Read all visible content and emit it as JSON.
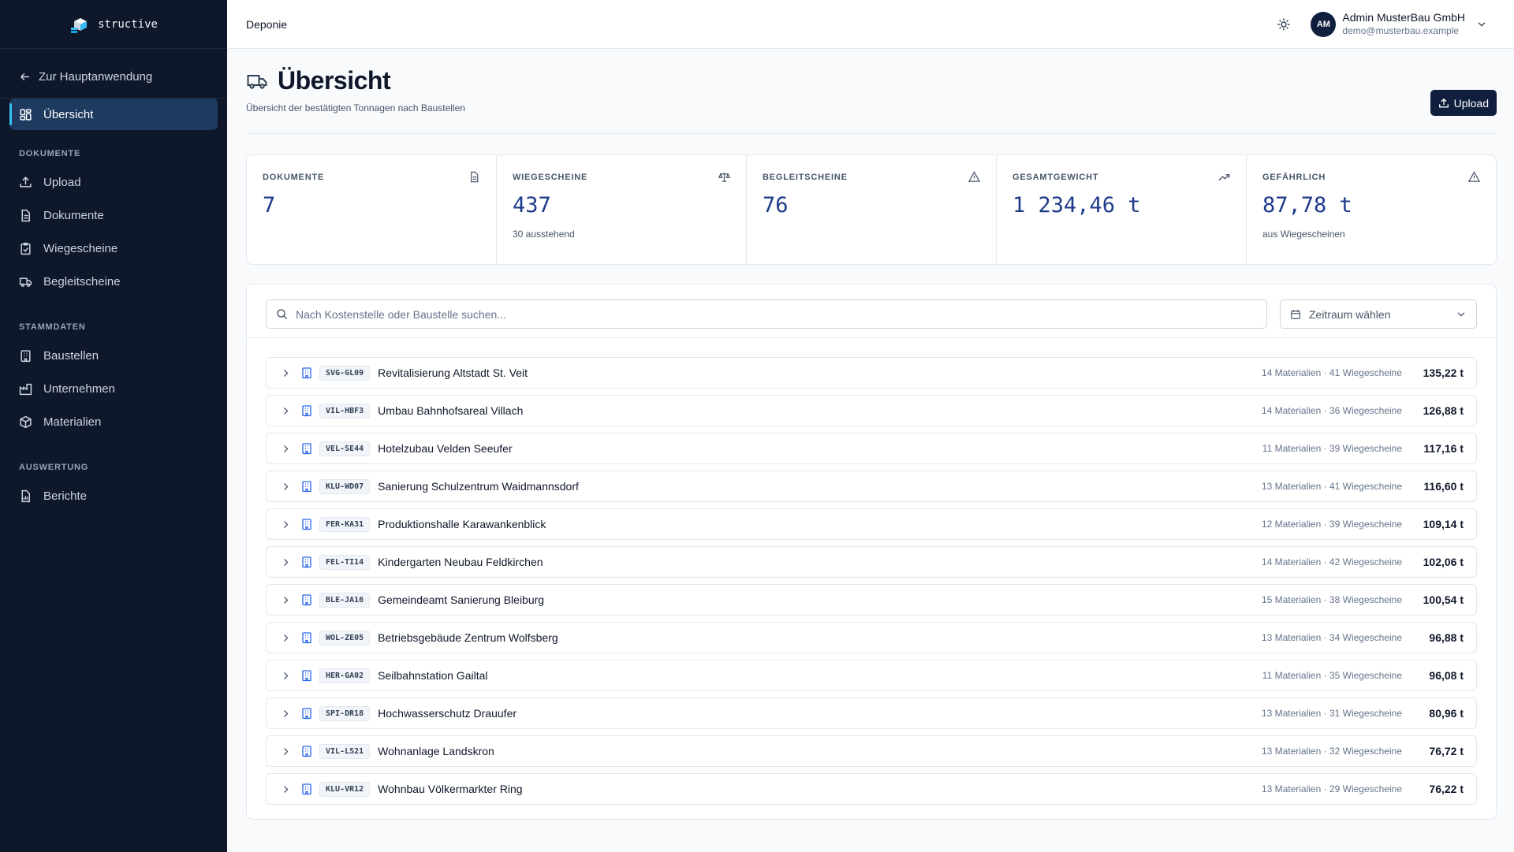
{
  "brand": {
    "name": "structive"
  },
  "sidebar": {
    "back_label": "Zur Hauptanwendung",
    "top_item": {
      "label": "Übersicht",
      "icon": "dashboard-icon",
      "active": true
    },
    "sections": [
      {
        "title": "DOKUMENTE",
        "items": [
          {
            "label": "Upload",
            "icon": "upload-icon"
          },
          {
            "label": "Dokumente",
            "icon": "document-icon"
          },
          {
            "label": "Wiegescheine",
            "icon": "clipboard-check-icon"
          },
          {
            "label": "Begleitscheine",
            "icon": "truck-icon"
          }
        ]
      },
      {
        "title": "STAMMDATEN",
        "items": [
          {
            "label": "Baustellen",
            "icon": "building-icon"
          },
          {
            "label": "Unternehmen",
            "icon": "factory-icon"
          },
          {
            "label": "Materialien",
            "icon": "package-icon"
          }
        ]
      },
      {
        "title": "AUSWERTUNG",
        "items": [
          {
            "label": "Berichte",
            "icon": "report-icon"
          }
        ]
      }
    ]
  },
  "topbar": {
    "breadcrumb": "Deponie",
    "user": {
      "initials": "AM",
      "name": "Admin MusterBau GmbH",
      "email": "demo@musterbau.example"
    }
  },
  "page": {
    "title": "Übersicht",
    "subtitle": "Übersicht der bestätigten Tonnagen nach Baustellen",
    "upload_label": "Upload"
  },
  "stats": [
    {
      "label": "DOKUMENTE",
      "value": "7",
      "note": "",
      "icon": "file-icon"
    },
    {
      "label": "WIEGESCHEINE",
      "value": "437",
      "note": "30 ausstehend",
      "icon": "scale-icon"
    },
    {
      "label": "BEGLEITSCHEINE",
      "value": "76",
      "note": "",
      "icon": "warning-icon"
    },
    {
      "label": "GESAMTGEWICHT",
      "value": "1 234,46 t",
      "note": "",
      "icon": "trending-up-icon"
    },
    {
      "label": "GEFÄHRLICH",
      "value": "87,78 t",
      "note": "aus Wiegescheinen",
      "icon": "warning-icon"
    }
  ],
  "filters": {
    "search_placeholder": "Nach Kostenstelle oder Baustelle suchen...",
    "period_label": "Zeitraum wählen"
  },
  "sites": [
    {
      "code": "SVG-GL09",
      "name": "Revitalisierung Altstadt St. Veit",
      "meta": "14 Materialien · 41 Wiegescheine",
      "weight": "135,22 t"
    },
    {
      "code": "VIL-HBF3",
      "name": "Umbau Bahnhofsareal Villach",
      "meta": "14 Materialien · 36 Wiegescheine",
      "weight": "126,88 t"
    },
    {
      "code": "VEL-SE44",
      "name": "Hotelzubau Velden Seeufer",
      "meta": "11 Materialien · 39 Wiegescheine",
      "weight": "117,16 t"
    },
    {
      "code": "KLU-WD07",
      "name": "Sanierung Schulzentrum Waidmannsdorf",
      "meta": "13 Materialien · 41 Wiegescheine",
      "weight": "116,60 t"
    },
    {
      "code": "FER-KA31",
      "name": "Produktionshalle Karawankenblick",
      "meta": "12 Materialien · 39 Wiegescheine",
      "weight": "109,14 t"
    },
    {
      "code": "FEL-TI14",
      "name": "Kindergarten Neubau Feldkirchen",
      "meta": "14 Materialien · 42 Wiegescheine",
      "weight": "102,06 t"
    },
    {
      "code": "BLE-JA16",
      "name": "Gemeindeamt Sanierung Bleiburg",
      "meta": "15 Materialien · 38 Wiegescheine",
      "weight": "100,54 t"
    },
    {
      "code": "WOL-ZE05",
      "name": "Betriebsgebäude Zentrum Wolfsberg",
      "meta": "13 Materialien · 34 Wiegescheine",
      "weight": "96,88 t"
    },
    {
      "code": "HER-GA02",
      "name": "Seilbahnstation Gailtal",
      "meta": "11 Materialien · 35 Wiegescheine",
      "weight": "96,08 t"
    },
    {
      "code": "SPI-DR18",
      "name": "Hochwasserschutz Drauufer",
      "meta": "13 Materialien · 31 Wiegescheine",
      "weight": "80,96 t"
    },
    {
      "code": "VIL-LS21",
      "name": "Wohnanlage Landskron",
      "meta": "13 Materialien · 32 Wiegescheine",
      "weight": "76,72 t"
    },
    {
      "code": "KLU-VR12",
      "name": "Wohnbau Völkermarkter Ring",
      "meta": "13 Materialien · 29 Wiegescheine",
      "weight": "76,22 t"
    }
  ]
}
